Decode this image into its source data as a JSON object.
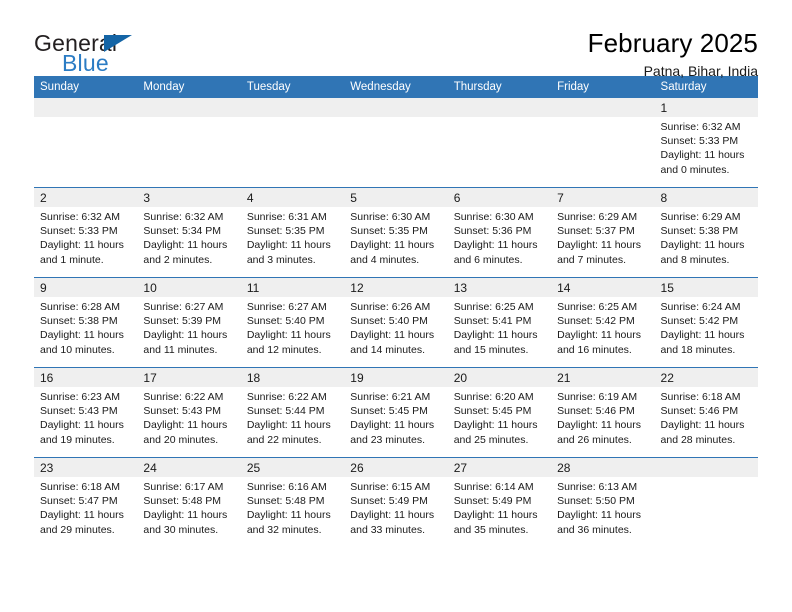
{
  "brand": {
    "name_top": "General",
    "name_bottom": "Blue",
    "flag_icon": "triangle-flag-icon",
    "accent_color": "#2b7cc4",
    "flag_color": "#1464a5"
  },
  "header": {
    "title": "February 2025",
    "subtitle": "Patna, Bihar, India"
  },
  "calendar": {
    "header_bg": "#3075b5",
    "daynum_bg": "#efefef",
    "weekdays": [
      "Sunday",
      "Monday",
      "Tuesday",
      "Wednesday",
      "Thursday",
      "Friday",
      "Saturday"
    ],
    "weeks": [
      [
        {
          "day": "",
          "sunrise": "",
          "sunset": "",
          "daylight1": "",
          "daylight2": ""
        },
        {
          "day": "",
          "sunrise": "",
          "sunset": "",
          "daylight1": "",
          "daylight2": ""
        },
        {
          "day": "",
          "sunrise": "",
          "sunset": "",
          "daylight1": "",
          "daylight2": ""
        },
        {
          "day": "",
          "sunrise": "",
          "sunset": "",
          "daylight1": "",
          "daylight2": ""
        },
        {
          "day": "",
          "sunrise": "",
          "sunset": "",
          "daylight1": "",
          "daylight2": ""
        },
        {
          "day": "",
          "sunrise": "",
          "sunset": "",
          "daylight1": "",
          "daylight2": ""
        },
        {
          "day": "1",
          "sunrise": "Sunrise: 6:32 AM",
          "sunset": "Sunset: 5:33 PM",
          "daylight1": "Daylight: 11 hours",
          "daylight2": "and 0 minutes."
        }
      ],
      [
        {
          "day": "2",
          "sunrise": "Sunrise: 6:32 AM",
          "sunset": "Sunset: 5:33 PM",
          "daylight1": "Daylight: 11 hours",
          "daylight2": "and 1 minute."
        },
        {
          "day": "3",
          "sunrise": "Sunrise: 6:32 AM",
          "sunset": "Sunset: 5:34 PM",
          "daylight1": "Daylight: 11 hours",
          "daylight2": "and 2 minutes."
        },
        {
          "day": "4",
          "sunrise": "Sunrise: 6:31 AM",
          "sunset": "Sunset: 5:35 PM",
          "daylight1": "Daylight: 11 hours",
          "daylight2": "and 3 minutes."
        },
        {
          "day": "5",
          "sunrise": "Sunrise: 6:30 AM",
          "sunset": "Sunset: 5:35 PM",
          "daylight1": "Daylight: 11 hours",
          "daylight2": "and 4 minutes."
        },
        {
          "day": "6",
          "sunrise": "Sunrise: 6:30 AM",
          "sunset": "Sunset: 5:36 PM",
          "daylight1": "Daylight: 11 hours",
          "daylight2": "and 6 minutes."
        },
        {
          "day": "7",
          "sunrise": "Sunrise: 6:29 AM",
          "sunset": "Sunset: 5:37 PM",
          "daylight1": "Daylight: 11 hours",
          "daylight2": "and 7 minutes."
        },
        {
          "day": "8",
          "sunrise": "Sunrise: 6:29 AM",
          "sunset": "Sunset: 5:38 PM",
          "daylight1": "Daylight: 11 hours",
          "daylight2": "and 8 minutes."
        }
      ],
      [
        {
          "day": "9",
          "sunrise": "Sunrise: 6:28 AM",
          "sunset": "Sunset: 5:38 PM",
          "daylight1": "Daylight: 11 hours",
          "daylight2": "and 10 minutes."
        },
        {
          "day": "10",
          "sunrise": "Sunrise: 6:27 AM",
          "sunset": "Sunset: 5:39 PM",
          "daylight1": "Daylight: 11 hours",
          "daylight2": "and 11 minutes."
        },
        {
          "day": "11",
          "sunrise": "Sunrise: 6:27 AM",
          "sunset": "Sunset: 5:40 PM",
          "daylight1": "Daylight: 11 hours",
          "daylight2": "and 12 minutes."
        },
        {
          "day": "12",
          "sunrise": "Sunrise: 6:26 AM",
          "sunset": "Sunset: 5:40 PM",
          "daylight1": "Daylight: 11 hours",
          "daylight2": "and 14 minutes."
        },
        {
          "day": "13",
          "sunrise": "Sunrise: 6:25 AM",
          "sunset": "Sunset: 5:41 PM",
          "daylight1": "Daylight: 11 hours",
          "daylight2": "and 15 minutes."
        },
        {
          "day": "14",
          "sunrise": "Sunrise: 6:25 AM",
          "sunset": "Sunset: 5:42 PM",
          "daylight1": "Daylight: 11 hours",
          "daylight2": "and 16 minutes."
        },
        {
          "day": "15",
          "sunrise": "Sunrise: 6:24 AM",
          "sunset": "Sunset: 5:42 PM",
          "daylight1": "Daylight: 11 hours",
          "daylight2": "and 18 minutes."
        }
      ],
      [
        {
          "day": "16",
          "sunrise": "Sunrise: 6:23 AM",
          "sunset": "Sunset: 5:43 PM",
          "daylight1": "Daylight: 11 hours",
          "daylight2": "and 19 minutes."
        },
        {
          "day": "17",
          "sunrise": "Sunrise: 6:22 AM",
          "sunset": "Sunset: 5:43 PM",
          "daylight1": "Daylight: 11 hours",
          "daylight2": "and 20 minutes."
        },
        {
          "day": "18",
          "sunrise": "Sunrise: 6:22 AM",
          "sunset": "Sunset: 5:44 PM",
          "daylight1": "Daylight: 11 hours",
          "daylight2": "and 22 minutes."
        },
        {
          "day": "19",
          "sunrise": "Sunrise: 6:21 AM",
          "sunset": "Sunset: 5:45 PM",
          "daylight1": "Daylight: 11 hours",
          "daylight2": "and 23 minutes."
        },
        {
          "day": "20",
          "sunrise": "Sunrise: 6:20 AM",
          "sunset": "Sunset: 5:45 PM",
          "daylight1": "Daylight: 11 hours",
          "daylight2": "and 25 minutes."
        },
        {
          "day": "21",
          "sunrise": "Sunrise: 6:19 AM",
          "sunset": "Sunset: 5:46 PM",
          "daylight1": "Daylight: 11 hours",
          "daylight2": "and 26 minutes."
        },
        {
          "day": "22",
          "sunrise": "Sunrise: 6:18 AM",
          "sunset": "Sunset: 5:46 PM",
          "daylight1": "Daylight: 11 hours",
          "daylight2": "and 28 minutes."
        }
      ],
      [
        {
          "day": "23",
          "sunrise": "Sunrise: 6:18 AM",
          "sunset": "Sunset: 5:47 PM",
          "daylight1": "Daylight: 11 hours",
          "daylight2": "and 29 minutes."
        },
        {
          "day": "24",
          "sunrise": "Sunrise: 6:17 AM",
          "sunset": "Sunset: 5:48 PM",
          "daylight1": "Daylight: 11 hours",
          "daylight2": "and 30 minutes."
        },
        {
          "day": "25",
          "sunrise": "Sunrise: 6:16 AM",
          "sunset": "Sunset: 5:48 PM",
          "daylight1": "Daylight: 11 hours",
          "daylight2": "and 32 minutes."
        },
        {
          "day": "26",
          "sunrise": "Sunrise: 6:15 AM",
          "sunset": "Sunset: 5:49 PM",
          "daylight1": "Daylight: 11 hours",
          "daylight2": "and 33 minutes."
        },
        {
          "day": "27",
          "sunrise": "Sunrise: 6:14 AM",
          "sunset": "Sunset: 5:49 PM",
          "daylight1": "Daylight: 11 hours",
          "daylight2": "and 35 minutes."
        },
        {
          "day": "28",
          "sunrise": "Sunrise: 6:13 AM",
          "sunset": "Sunset: 5:50 PM",
          "daylight1": "Daylight: 11 hours",
          "daylight2": "and 36 minutes."
        },
        {
          "day": "",
          "sunrise": "",
          "sunset": "",
          "daylight1": "",
          "daylight2": ""
        }
      ]
    ]
  }
}
